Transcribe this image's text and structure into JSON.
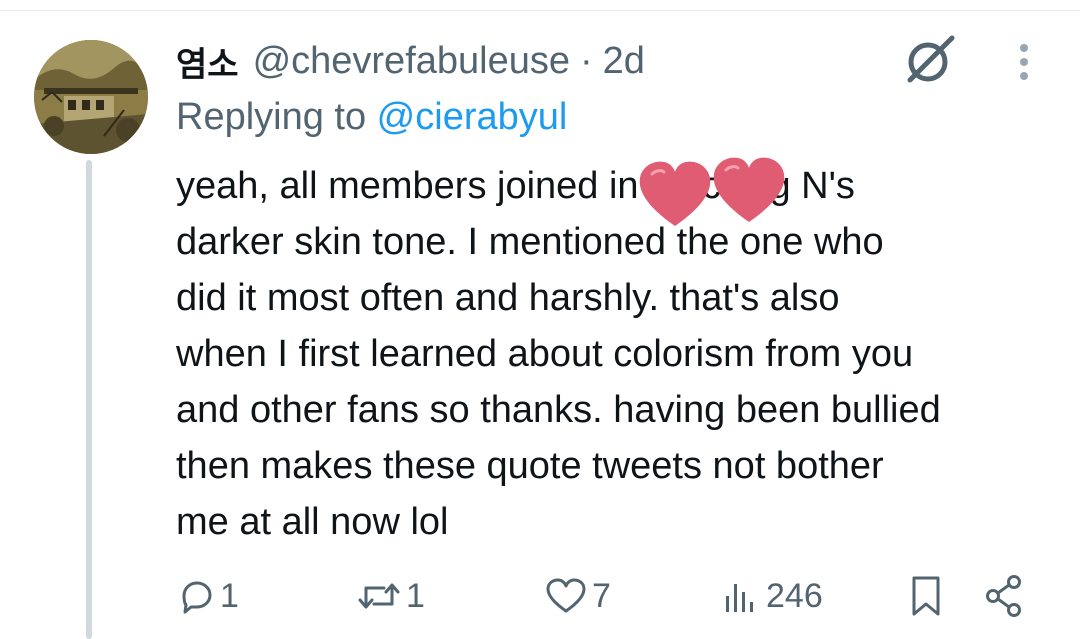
{
  "tweet": {
    "display_name": "염소",
    "handle": "@chevrefabuleuse",
    "separator": "·",
    "time": "2d",
    "replying_prefix": "Replying to ",
    "replying_handle": "@cierabyul",
    "text_lines": [
      "yeah, all members joined in mocking N's",
      "darker skin tone. I mentioned the one who",
      "did it most often and harshly. that's also",
      "when I first learned about colorism from you",
      "and other fans so thanks. having been bullied",
      "then makes these quote tweets not bother",
      "me at all now lol"
    ]
  },
  "actions": {
    "reply_count": "1",
    "retweet_count": "1",
    "like_count": "7",
    "view_count": "246"
  },
  "icons": {
    "avatar": "avatar-illustration",
    "top_right": [
      "grok-icon",
      "more-vertical-icon"
    ],
    "action_bar": [
      "reply-icon",
      "retweet-icon",
      "like-icon",
      "views-icon",
      "bookmark-icon",
      "share-icon"
    ],
    "sticker": "heart-sticker"
  },
  "colors": {
    "text": "#0f1419",
    "secondary": "#536471",
    "link": "#1d9bf0",
    "thread_line": "#cfd9de",
    "sticker": "#e05c72"
  }
}
